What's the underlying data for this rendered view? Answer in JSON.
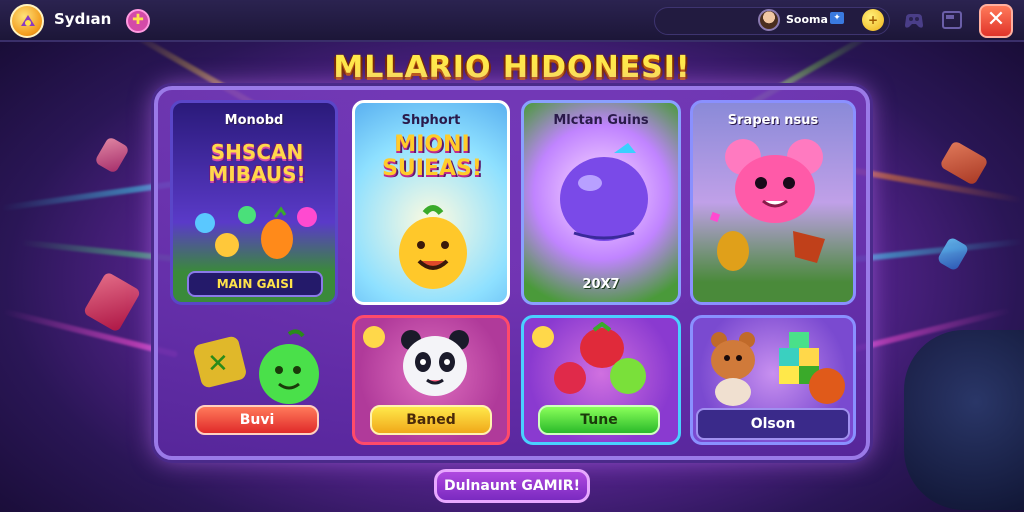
{
  "header": {
    "app_title": "Sydıan",
    "user_name": "Sooma"
  },
  "main": {
    "title": "MLLARIO HIDONESI!",
    "cards": [
      {
        "title": "Monobd",
        "promo": "SHSCAN MIBAUS!",
        "button": "MAIN GAISI"
      },
      {
        "title": "Shphort",
        "promo": "MIONI SUIEAS!"
      },
      {
        "title": "Mlctan Guins",
        "caption": "20X7"
      },
      {
        "title": "Srapen nsus"
      }
    ],
    "actions": [
      {
        "label": "Buvi"
      },
      {
        "label": "Baned"
      },
      {
        "label": "Tune"
      },
      {
        "label": "Olson"
      }
    ],
    "bottom_button": "Dulnaunt GAMIR!"
  },
  "icons": [
    "logo-icon",
    "plus-icon",
    "avatar",
    "flag-icon",
    "coin-icon",
    "gamepad-icon",
    "window-icon",
    "close-icon"
  ],
  "colors": {
    "accent_yellow": "#ffe94a",
    "panel_purple": "#7a3cbe",
    "close_red": "#e0342a"
  }
}
